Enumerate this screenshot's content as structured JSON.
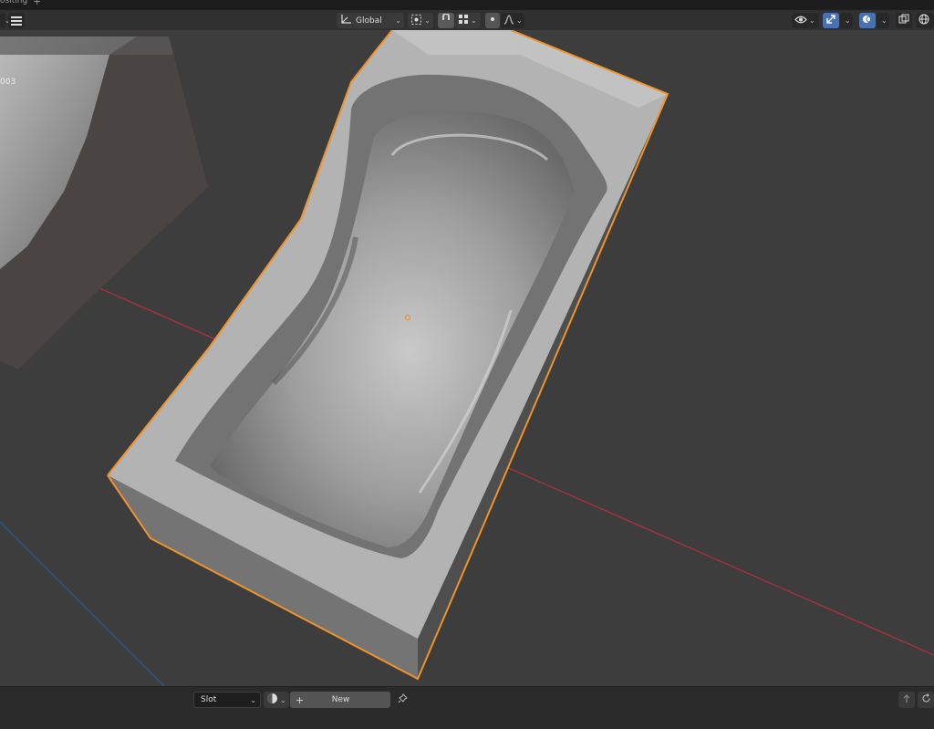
{
  "workspace_tab": {
    "label": "ositing",
    "add": "+"
  },
  "header": {
    "orientation": {
      "icon": "transform-orientation-icon",
      "label": "Global"
    },
    "pivot_icon": "pivot-point-icon",
    "snap_icon": "snap-icon",
    "snap_target_icon": "snap-grid-icon",
    "proportional_icon": "proportional-editing-icon",
    "falloff_icon": "falloff-curve-icon",
    "visibility_icon": "visibility-eye-icon",
    "gizmo_icon": "gizmo-icon",
    "overlay_icon": "overlays-icon",
    "xray_icon": "xray-icon",
    "shading_icon": "shading-wireframe-icon"
  },
  "viewport": {
    "object_label": "003",
    "colors": {
      "selection_outline": "#f0932a",
      "x_axis": "#b3303f",
      "y_axis": "#2f5b8c",
      "background": "#3d3d3d"
    }
  },
  "footer": {
    "slot_label": "Slot",
    "new_label": "New",
    "plus": "+"
  }
}
